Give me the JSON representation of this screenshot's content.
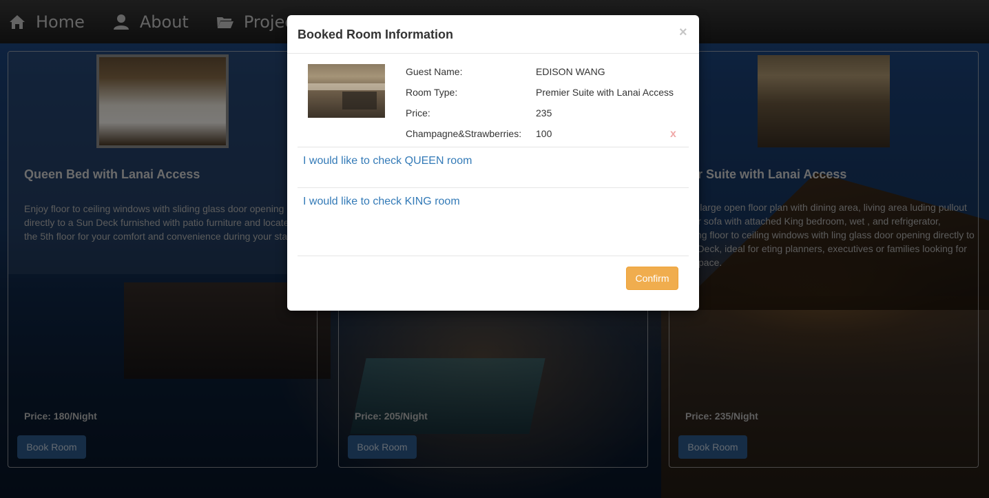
{
  "navbar": {
    "items": [
      {
        "label": "Home",
        "icon": "home-icon"
      },
      {
        "label": "About",
        "icon": "user-icon"
      },
      {
        "label": "Projects",
        "icon": "folder-open-icon"
      }
    ]
  },
  "rooms": [
    {
      "title": "Queen Bed with Lanai Access",
      "description": "Enjoy floor to ceiling windows with sliding glass door opening directly to a Sun Deck furnished with patio furniture and located on the 5th floor for your comfort and convenience during your stay.",
      "price": "Price: 180/Night",
      "button": "Book Room"
    },
    {
      "title": "",
      "description": "",
      "price": "Price: 205/Night",
      "button": "Book Room"
    },
    {
      "title": "emier Suite with Lanai Access",
      "description": "oy this large open floor plan with dining area, living area luding pullout sleeper sofa with attached King bedroom, wet , and refrigerator, featuring floor to ceiling windows with ling glass door opening directly to a Sun Deck, ideal for eting planners, executives or families looking for extra space.",
      "price": "Price: 235/Night",
      "button": "Book Room"
    }
  ],
  "modal": {
    "title": "Booked Room Information",
    "close": "×",
    "info": [
      {
        "label": "Guest Name:",
        "value": "EDISON WANG"
      },
      {
        "label": "Room Type:",
        "value": "Premier Suite with Lanai Access"
      },
      {
        "label": "Price:",
        "value": "235"
      },
      {
        "label": "Champagne&Strawberries:",
        "value": "100"
      }
    ],
    "remove": "x",
    "links": [
      "I would like to check QUEEN room",
      "I would like to check KING room"
    ],
    "confirm": "Confirm"
  },
  "colors": {
    "link": "#337ab7",
    "confirm": "#f0ad4e",
    "book_button": "#2d5b8d"
  }
}
